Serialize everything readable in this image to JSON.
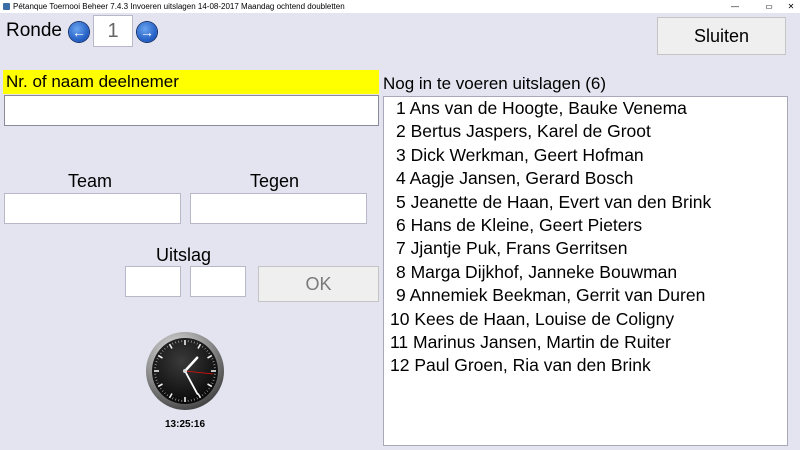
{
  "window": {
    "title": "Pétanque Toernooi Beheer 7.4.3  Invoeren uitslagen 14-08-2017 Maandag ochtend doubletten",
    "minimize_symbol": "—",
    "maximize_symbol": "▭",
    "close_symbol": "✕"
  },
  "round": {
    "label": "Ronde",
    "value": "1",
    "prev_icon": "arrow-left-icon",
    "next_icon": "arrow-right-icon"
  },
  "buttons": {
    "close_label": "Sluiten",
    "ok_label": "OK"
  },
  "participant": {
    "label": "Nr. of naam deelnemer",
    "value": ""
  },
  "match": {
    "team_label": "Team",
    "tegen_label": "Tegen",
    "team_value": "",
    "tegen_value": ""
  },
  "score": {
    "label": "Uitslag",
    "team_score": "",
    "tegen_score": ""
  },
  "clock": {
    "time": "13:25:16"
  },
  "pending": {
    "header": "Nog in te voeren uitslagen (6)",
    "items": [
      "1 Ans van de Hoogte, Bauke Venema",
      "2 Bertus Jaspers, Karel de Groot",
      "3 Dick Werkman, Geert Hofman",
      "4 Aagje Jansen, Gerard Bosch",
      "5 Jeanette de Haan, Evert van den Brink",
      "6 Hans de Kleine, Geert Pieters",
      "7 Jjantje Puk, Frans Gerritsen",
      "8 Marga Dijkhof, Janneke Bouwman",
      "9 Annemiek Beekman, Gerrit van Duren",
      "10 Kees de Haan, Louise de Coligny",
      "11 Marinus Jansen, Martin de Ruiter",
      "12 Paul Groen, Ria van den Brink"
    ]
  },
  "colors": {
    "background": "#e4e4f0",
    "highlight": "#ffff00",
    "arrow_blue": "#1f5bc2"
  }
}
